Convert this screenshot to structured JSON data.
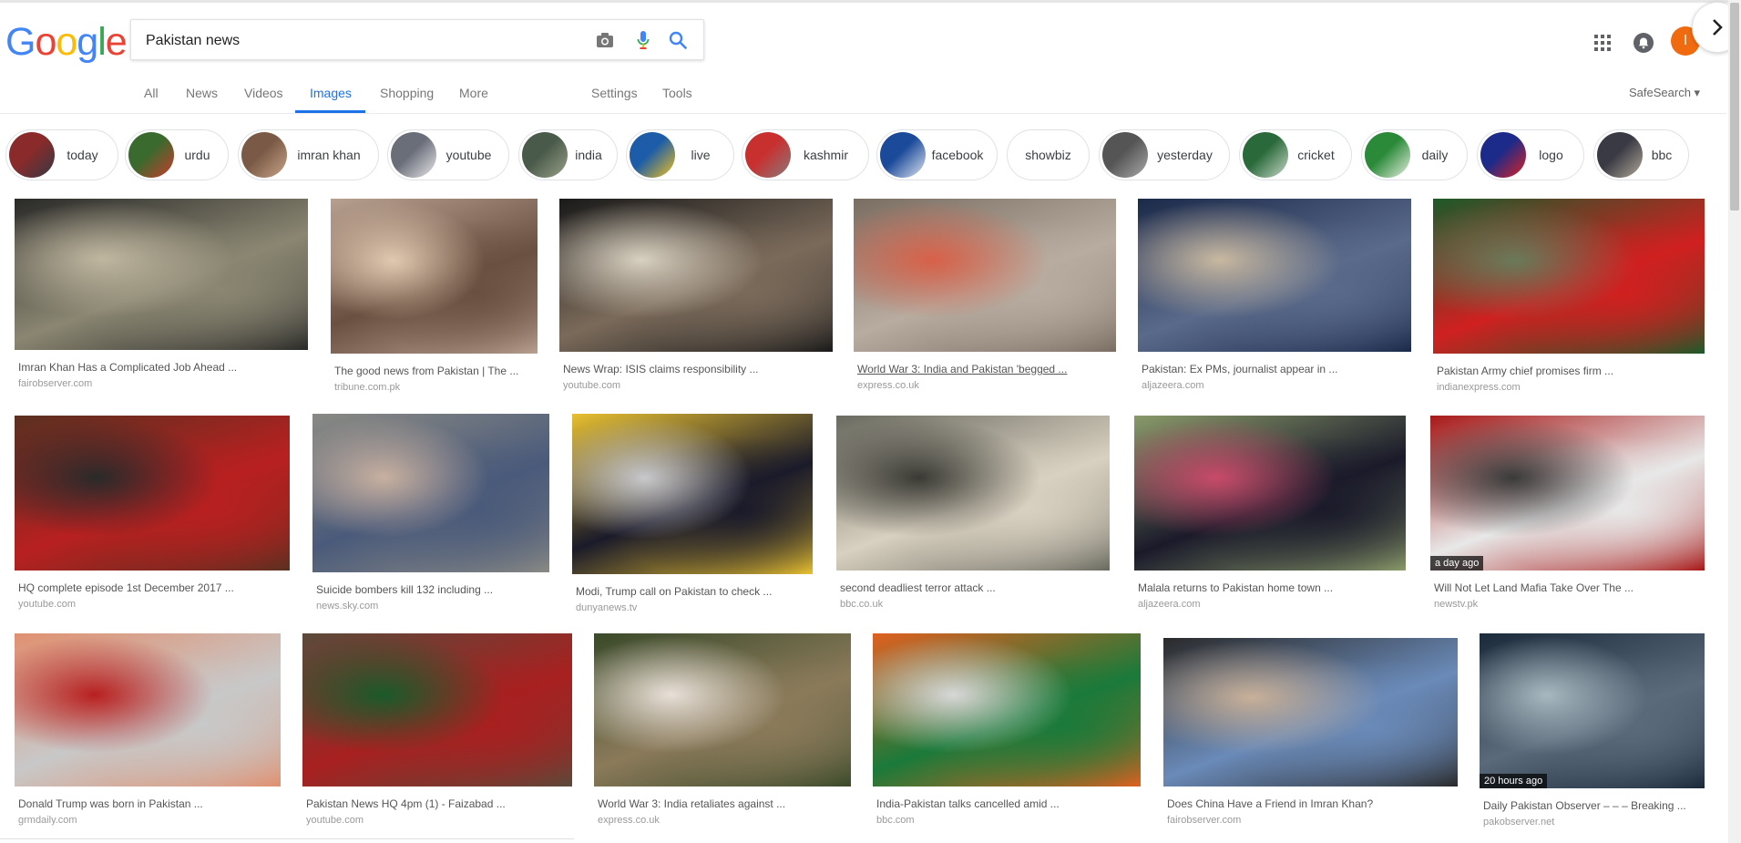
{
  "search": {
    "query": "Pakistan news"
  },
  "logo": [
    "G",
    "o",
    "o",
    "g",
    "l",
    "e"
  ],
  "avatar_initial": "I",
  "tabs": [
    {
      "label": "All",
      "active": false
    },
    {
      "label": "News",
      "active": false
    },
    {
      "label": "Videos",
      "active": false
    },
    {
      "label": "Images",
      "active": true
    },
    {
      "label": "Shopping",
      "active": false
    },
    {
      "label": "More",
      "active": false
    },
    {
      "label": "Settings",
      "active": false
    },
    {
      "label": "Tools",
      "active": false
    }
  ],
  "safesearch_label": "SafeSearch ▾",
  "chips": [
    {
      "label": "today",
      "colors": [
        "#8a2a2a",
        "#333a44"
      ]
    },
    {
      "label": "urdu",
      "colors": [
        "#3a6a2e",
        "#c83c2c"
      ]
    },
    {
      "label": "imran khan",
      "colors": [
        "#7a5a46",
        "#c9a48a"
      ]
    },
    {
      "label": "youtube",
      "colors": [
        "#6a6e78",
        "#e8e8ec"
      ]
    },
    {
      "label": "india",
      "colors": [
        "#4a5a4a",
        "#9aa28a"
      ]
    },
    {
      "label": "live",
      "colors": [
        "#1c5ca8",
        "#f0c020"
      ]
    },
    {
      "label": "kashmir",
      "colors": [
        "#c83030",
        "#8a7a7a"
      ]
    },
    {
      "label": "facebook",
      "colors": [
        "#1c4a9a",
        "#dfe6f0"
      ]
    },
    {
      "label": "showbiz",
      "colors": null
    },
    {
      "label": "yesterday",
      "colors": [
        "#555",
        "#aaa"
      ]
    },
    {
      "label": "cricket",
      "colors": [
        "#2a6a3a",
        "#c8d8c8"
      ]
    },
    {
      "label": "daily",
      "colors": [
        "#2a8a3a",
        "#e8f0e0"
      ]
    },
    {
      "label": "logo",
      "colors": [
        "#1c2a8a",
        "#d22"
      ]
    },
    {
      "label": "bbc",
      "colors": [
        "#3a3a44",
        "#b0a898"
      ]
    }
  ],
  "results": [
    {
      "title": "Imran Khan Has a Complicated Job Ahead ...",
      "source": "fairobserver.com",
      "colors": [
        "#2a2a28",
        "#8a8672",
        "#c0b7a0"
      ],
      "badge": null,
      "underline": false
    },
    {
      "title": "The good news from Pakistan | The ...",
      "source": "tribune.com.pk",
      "colors": [
        "#b8a090",
        "#6a5040",
        "#e0c8b0"
      ],
      "badge": null,
      "underline": false
    },
    {
      "title": "News Wrap: ISIS claims responsibility ...",
      "source": "youtube.com",
      "colors": [
        "#1a1a1a",
        "#7a6a5a",
        "#d8d0c0"
      ],
      "badge": null,
      "underline": false
    },
    {
      "title": "World War 3: India and Pakistan 'begged ...",
      "source": "express.co.uk",
      "colors": [
        "#7a6e62",
        "#b8aca0",
        "#d86048"
      ],
      "badge": null,
      "underline": true
    },
    {
      "title": "Pakistan: Ex PMs, journalist appear in ...",
      "source": "aljazeera.com",
      "colors": [
        "#1c2a4a",
        "#5a6a8a",
        "#c8b8a0"
      ],
      "badge": null,
      "underline": false
    },
    {
      "title": "Pakistan Army chief promises firm ...",
      "source": "indianexpress.com",
      "colors": [
        "#1c5a2a",
        "#d02020",
        "#6a7a5a"
      ],
      "badge": null,
      "underline": false
    },
    {
      "title": "HQ complete episode 1st December 2017 ...",
      "source": "youtube.com",
      "colors": [
        "#5a3020",
        "#b82020",
        "#2a2a2a"
      ],
      "badge": null,
      "underline": false
    },
    {
      "title": "Suicide bombers kill 132 including ...",
      "source": "news.sky.com",
      "colors": [
        "#8a8a84",
        "#4a5a7a",
        "#c8b0a0"
      ],
      "badge": null,
      "underline": false
    },
    {
      "title": "Modi, Trump call on Pakistan to check ...",
      "source": "dunyanews.tv",
      "colors": [
        "#e8c030",
        "#1a1a2a",
        "#c8c8cc"
      ],
      "badge": null,
      "underline": false
    },
    {
      "title": "second deadliest terror attack ...",
      "source": "bbc.co.uk",
      "colors": [
        "#6a6a60",
        "#d8d0c0",
        "#3a3a34"
      ],
      "badge": null,
      "underline": false
    },
    {
      "title": "Malala returns to Pakistan home town ...",
      "source": "aljazeera.com",
      "colors": [
        "#8a9a6a",
        "#1a1a2a",
        "#c84a6a"
      ],
      "badge": null,
      "underline": false
    },
    {
      "title": "Will Not Let Land Mafia Take Over The ...",
      "source": "newstv.pk",
      "colors": [
        "#a81818",
        "#e8e8e8",
        "#3a3a3a"
      ],
      "badge": "a day ago",
      "underline": false
    },
    {
      "title": "Donald Trump was born in Pakistan ...",
      "source": "grmdaily.com",
      "colors": [
        "#e09070",
        "#c8c8c8",
        "#b82020"
      ],
      "badge": null,
      "underline": false
    },
    {
      "title": "Pakistan News HQ 4pm (1) - Faizabad ...",
      "source": "youtube.com",
      "colors": [
        "#5a4a3a",
        "#a82020",
        "#1a5a2a"
      ],
      "badge": null,
      "underline": false
    },
    {
      "title": "World War 3: India retaliates against ...",
      "source": "express.co.uk",
      "colors": [
        "#3a4a2a",
        "#8a7a5a",
        "#e8e0d8"
      ],
      "badge": null,
      "underline": false
    },
    {
      "title": "India-Pakistan talks cancelled amid ...",
      "source": "bbc.com",
      "colors": [
        "#e06020",
        "#1a7a3a",
        "#d8d8d8"
      ],
      "badge": null,
      "underline": false
    },
    {
      "title": "Does China Have a Friend in Imran Khan?",
      "source": "fairobserver.com",
      "colors": [
        "#2a2a2a",
        "#6a8ab8",
        "#c8b098"
      ],
      "badge": null,
      "underline": false
    },
    {
      "title": "Daily Pakistan Observer – – – Breaking ...",
      "source": "pakobserver.net",
      "colors": [
        "#1a2a3a",
        "#5a6a7a",
        "#a8b8c0"
      ],
      "badge": "20 hours ago",
      "underline": false
    }
  ]
}
